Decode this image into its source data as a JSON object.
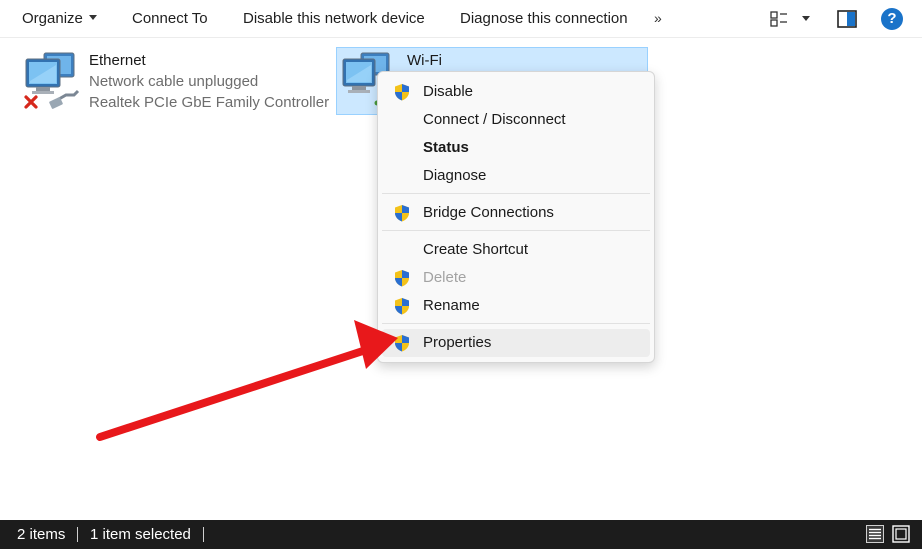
{
  "toolbar": {
    "organize": "Organize",
    "connect_to": "Connect To",
    "disable_device": "Disable this network device",
    "diagnose": "Diagnose this connection",
    "more": "»"
  },
  "items": {
    "ethernet": {
      "name": "Ethernet",
      "status": "Network cable unplugged",
      "adapter": "Realtek PCIe GbE Family Controller"
    },
    "wifi": {
      "name": "Wi-Fi"
    }
  },
  "context_menu": {
    "disable": "Disable",
    "connect_disconnect": "Connect / Disconnect",
    "status": "Status",
    "diagnose": "Diagnose",
    "bridge": "Bridge Connections",
    "create_shortcut": "Create Shortcut",
    "delete": "Delete",
    "rename": "Rename",
    "properties": "Properties"
  },
  "statusbar": {
    "count": "2 items",
    "selected": "1 item selected"
  },
  "colors": {
    "selection_bg": "#cce8ff",
    "arrow": "#e8181b",
    "help": "#1a73c9",
    "statusbar_bg": "#1c1c1c"
  },
  "icons": [
    "view-options-icon",
    "preview-pane-icon",
    "help-icon",
    "network-adapter-icon",
    "uac-shield-icon",
    "details-view-icon",
    "large-icons-view-icon"
  ]
}
